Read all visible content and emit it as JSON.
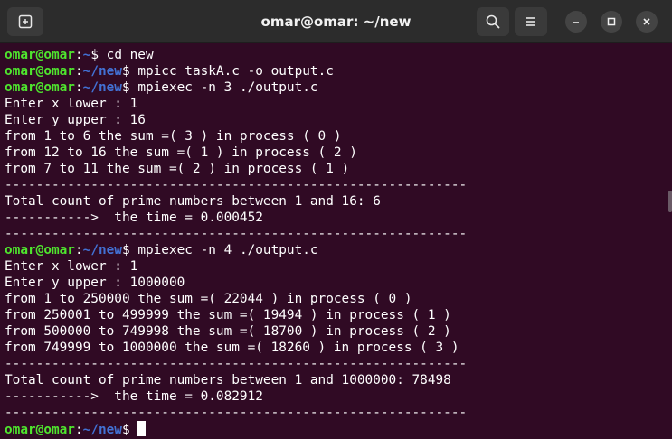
{
  "window": {
    "title": "omar@omar: ~/new"
  },
  "icons": {
    "new_tab": "new-tab-icon",
    "search": "search-icon",
    "menu": "hamburger-menu-icon",
    "minimize": "minimize-icon",
    "maximize": "maximize-icon",
    "close": "close-icon"
  },
  "colors": {
    "terminal_bg": "#300a24",
    "titlebar_bg": "#2c2c2c",
    "prompt_user": "#4fe52e",
    "prompt_path": "#4271d4",
    "text": "#ffffff"
  },
  "terminal": {
    "lines": [
      {
        "type": "prompt",
        "user": "omar@omar",
        "colon": ":",
        "path": "~",
        "symbol": "$ ",
        "command": "cd new"
      },
      {
        "type": "prompt",
        "user": "omar@omar",
        "colon": ":",
        "path": "~/new",
        "symbol": "$ ",
        "command": "mpicc taskA.c -o output.c"
      },
      {
        "type": "prompt",
        "user": "omar@omar",
        "colon": ":",
        "path": "~/new",
        "symbol": "$ ",
        "command": "mpiexec -n 3 ./output.c"
      },
      {
        "type": "output",
        "text": "Enter x lower : 1"
      },
      {
        "type": "output",
        "text": "Enter y upper : 16"
      },
      {
        "type": "output",
        "text": "from 1 to 6 the sum =( 3 ) in process ( 0 )"
      },
      {
        "type": "output",
        "text": "from 12 to 16 the sum =( 1 ) in process ( 2 )"
      },
      {
        "type": "output",
        "text": "from 7 to 11 the sum =( 2 ) in process ( 1 )"
      },
      {
        "type": "output",
        "text": "-----------------------------------------------------------"
      },
      {
        "type": "output",
        "text": "Total count of prime numbers between 1 and 16: 6"
      },
      {
        "type": "output",
        "text": "----------->  the time = 0.000452"
      },
      {
        "type": "output",
        "text": "-----------------------------------------------------------"
      },
      {
        "type": "prompt",
        "user": "omar@omar",
        "colon": ":",
        "path": "~/new",
        "symbol": "$ ",
        "command": "mpiexec -n 4 ./output.c"
      },
      {
        "type": "output",
        "text": "Enter x lower : 1"
      },
      {
        "type": "output",
        "text": "Enter y upper : 1000000"
      },
      {
        "type": "output",
        "text": "from 1 to 250000 the sum =( 22044 ) in process ( 0 )"
      },
      {
        "type": "output",
        "text": "from 250001 to 499999 the sum =( 19494 ) in process ( 1 )"
      },
      {
        "type": "output",
        "text": "from 500000 to 749998 the sum =( 18700 ) in process ( 2 )"
      },
      {
        "type": "output",
        "text": "from 749999 to 1000000 the sum =( 18260 ) in process ( 3 )"
      },
      {
        "type": "output",
        "text": "-----------------------------------------------------------"
      },
      {
        "type": "output",
        "text": "Total count of prime numbers between 1 and 1000000: 78498"
      },
      {
        "type": "output",
        "text": "----------->  the time = 0.082912"
      },
      {
        "type": "output",
        "text": "-----------------------------------------------------------"
      },
      {
        "type": "prompt",
        "user": "omar@omar",
        "colon": ":",
        "path": "~/new",
        "symbol": "$ ",
        "command": "",
        "cursor": true
      }
    ]
  }
}
